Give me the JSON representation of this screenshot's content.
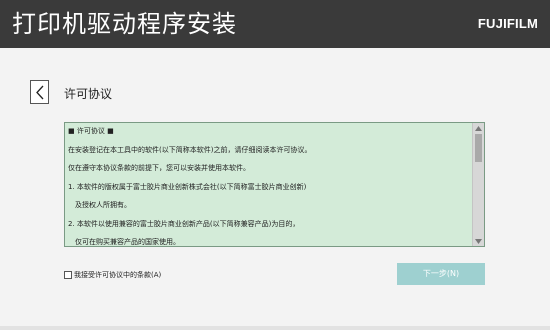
{
  "header": {
    "title": "打印机驱动程序安装",
    "brand": "FUJIFILM"
  },
  "nav": {
    "back_icon": "chevron-left-icon",
    "section_title": "许可协议"
  },
  "license": {
    "heading": "■ 许可协议 ■",
    "p1": "在安装登记在本工具中的软件(以下简称本软件)之前，请仔细阅读本许可协议。",
    "p2": "仅在遵守本协议条款的前提下，您可以安装并使用本软件。",
    "p3a": "1. 本软件的版权属于富士胶片商业创新株式会社(以下简称富士胶片商业创新)",
    "p3b": "及授权人所拥有。",
    "p4a": "2. 本软件以使用兼容的富士胶片商业创新产品(以下简称兼容产品)为目的，",
    "p4b": "仅可在购买兼容产品的国家使用。"
  },
  "accept": {
    "label": "我接受许可协议中的条款(A)",
    "checked": false
  },
  "buttons": {
    "next_label": "下一步(N)",
    "next_enabled": false
  },
  "colors": {
    "header_bg": "#3a3a3a",
    "license_bg": "#d3ebd8",
    "next_button_bg": "#9ed0d0"
  }
}
